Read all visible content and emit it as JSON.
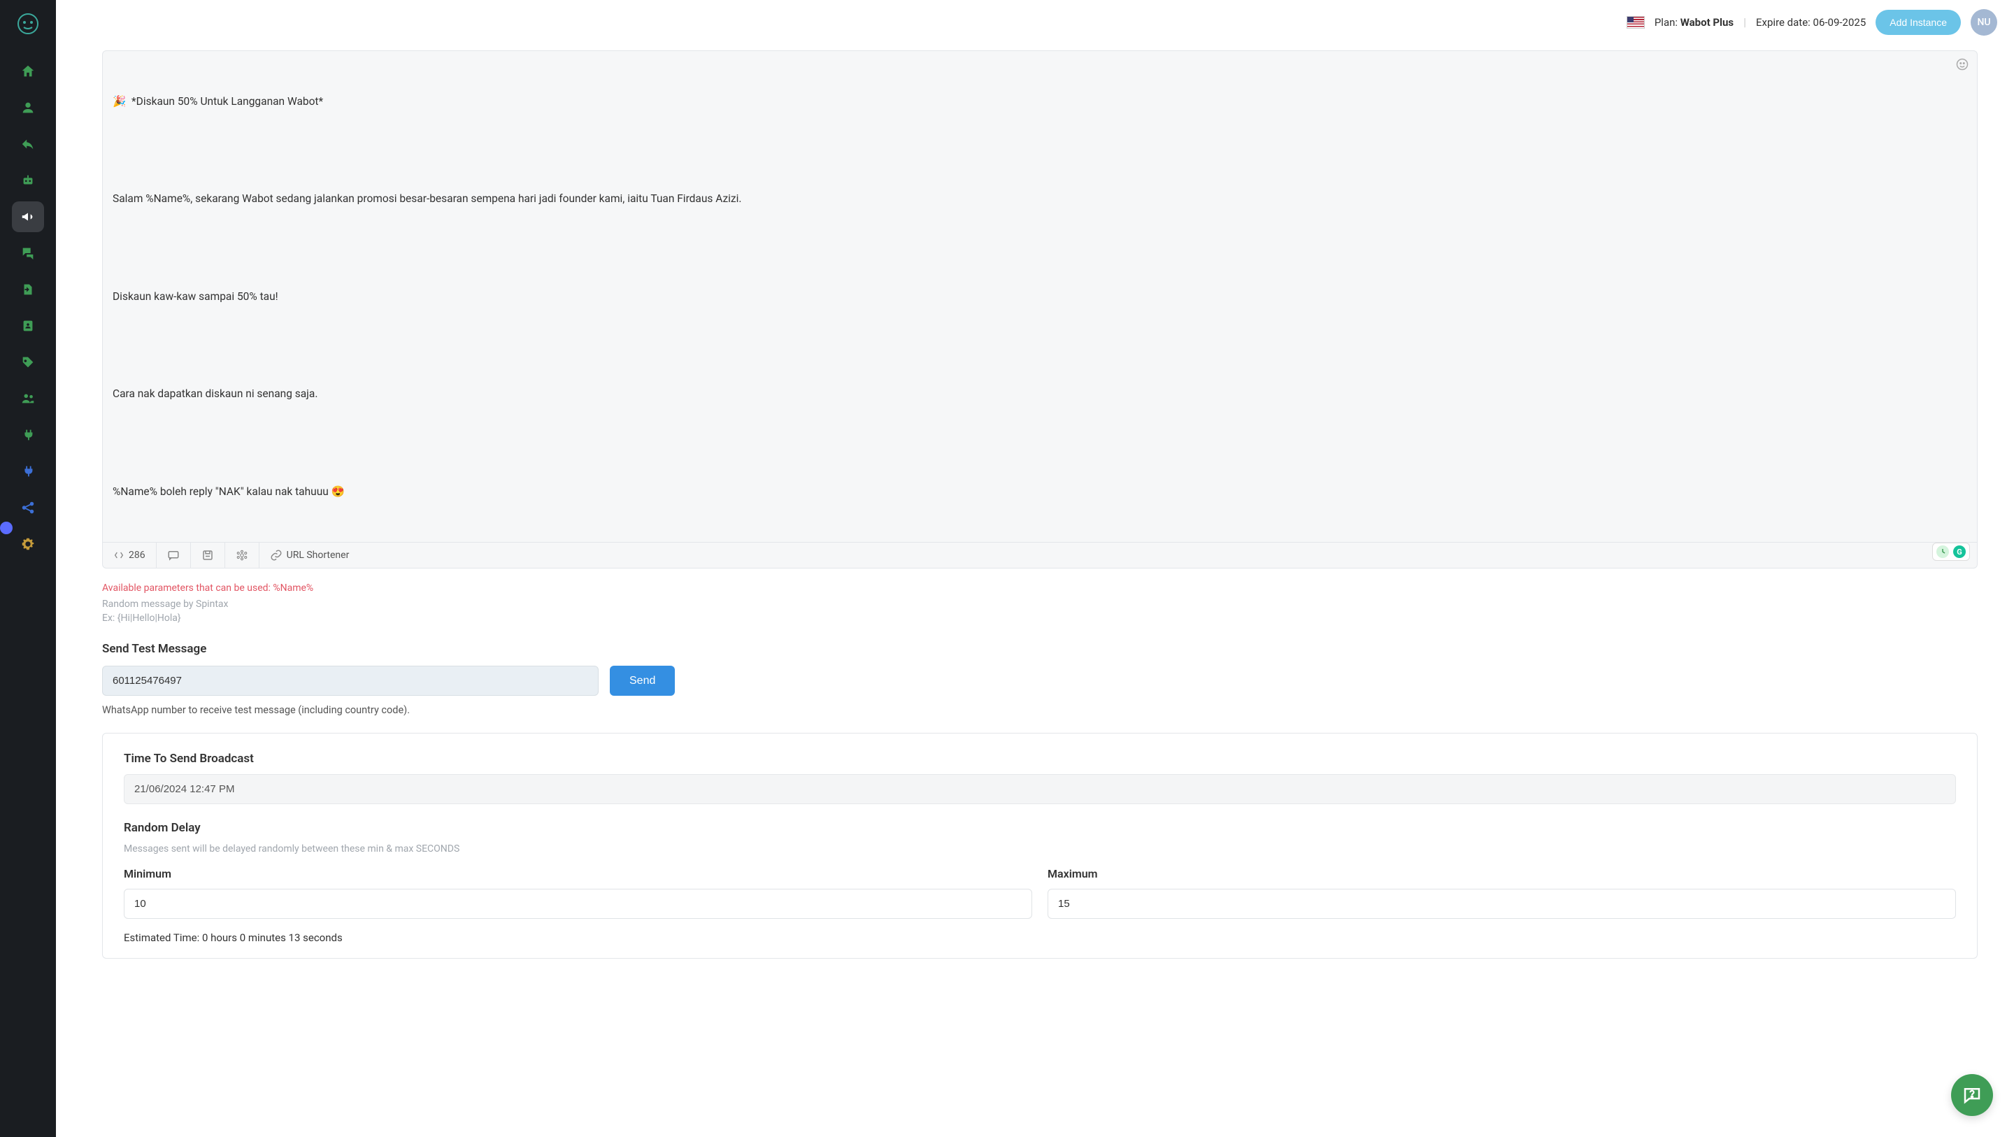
{
  "topbar": {
    "plan_prefix": "Plan: ",
    "plan_name": "Wabot Plus",
    "expire_prefix": "Expire date: ",
    "expire_date": "06-09-2025",
    "add_instance": "Add Instance",
    "avatar_initials": "NU"
  },
  "editor": {
    "line1": "🎉  *Diskaun 50% Untuk Langganan Wabot*",
    "line2": "Salam %Name%, sekarang Wabot sedang jalankan promosi besar-besaran sempena hari jadi founder kami, iaitu Tuan Firdaus Azizi.",
    "line3": "Diskaun kaw-kaw sampai 50% tau!",
    "line4": "Cara nak dapatkan diskaun ni senang saja.",
    "line5": "%Name% boleh reply \"NAK\" kalau nak tahuuu 😍",
    "char_count": "286",
    "url_shortener": "URL Shortener"
  },
  "hints": {
    "params": "Available parameters that can be used: %Name%",
    "spintax1": "Random message by Spintax",
    "spintax2": "Ex: {Hi|Hello|Hola}"
  },
  "test": {
    "label": "Send Test Message",
    "number": "601125476497",
    "send": "Send",
    "help": "WhatsApp number to receive test message (including country code)."
  },
  "broadcast": {
    "time_label": "Time To Send Broadcast",
    "time_value": "21/06/2024 12:47 PM",
    "random_delay_label": "Random Delay",
    "random_delay_help": "Messages sent will be delayed randomly between these min & max SECONDS",
    "min_label": "Minimum",
    "min_value": "10",
    "max_label": "Maximum",
    "max_value": "15",
    "estimated": "Estimated Time: 0 hours 0 minutes 13 seconds"
  },
  "sidebar": {
    "icons": [
      "home",
      "user",
      "reply",
      "robot",
      "bullhorn",
      "comments",
      "export",
      "address-book",
      "tags",
      "users",
      "plug",
      "plug-alt",
      "share-nodes",
      "gear"
    ]
  }
}
